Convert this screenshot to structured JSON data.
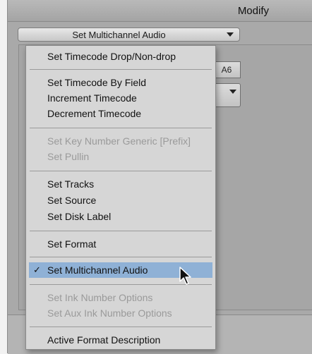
{
  "window": {
    "title": "Modify"
  },
  "dropdown": {
    "selected": "Set Multichannel Audio"
  },
  "side_button": {
    "label": "A6"
  },
  "menu": {
    "items": [
      {
        "label": "Set Timecode Drop/Non-drop",
        "enabled": true
      },
      {
        "label": "Set Timecode By Field",
        "enabled": true
      },
      {
        "label": "Increment Timecode",
        "enabled": true
      },
      {
        "label": "Decrement Timecode",
        "enabled": true
      },
      {
        "label": "Set Key Number Generic [Prefix]",
        "enabled": false
      },
      {
        "label": "Set Pullin",
        "enabled": false
      },
      {
        "label": "Set Tracks",
        "enabled": true
      },
      {
        "label": "Set Source",
        "enabled": true
      },
      {
        "label": "Set Disk Label",
        "enabled": true
      },
      {
        "label": "Set Format",
        "enabled": true
      },
      {
        "label": "Set Multichannel Audio",
        "enabled": true,
        "checked": true,
        "highlighted": true
      },
      {
        "label": "Set Ink Number Options",
        "enabled": false
      },
      {
        "label": "Set Aux Ink Number Options",
        "enabled": false
      },
      {
        "label": "Active Format Description",
        "enabled": true
      }
    ],
    "check_mark": "✓"
  },
  "icons": {
    "dropdown_arrow": "chevron-down-icon",
    "cursor": "mouse-pointer-icon"
  },
  "colors": {
    "highlight": "#8fb1d6",
    "menu_bg": "#d6d6d6",
    "disabled_text": "#9a9a9a"
  }
}
